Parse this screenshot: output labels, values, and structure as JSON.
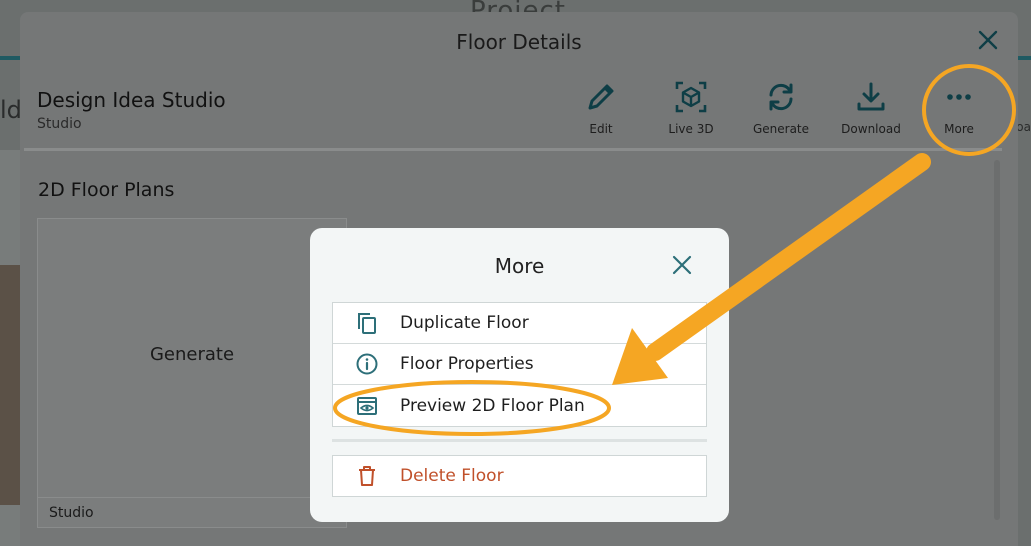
{
  "background": {
    "title": "Project",
    "left_fragment": "ld",
    "right_fragment": "oa"
  },
  "dialog": {
    "title": "Floor Details",
    "project_name": "Design Idea Studio",
    "project_type": "Studio",
    "toolbar": [
      {
        "label": "Edit",
        "icon": "pencil-icon"
      },
      {
        "label": "Live 3D",
        "icon": "cube-scan-icon"
      },
      {
        "label": "Generate",
        "icon": "sync-icon"
      },
      {
        "label": "Download",
        "icon": "download-icon"
      },
      {
        "label": "More",
        "icon": "more-dots-icon"
      }
    ],
    "section_title": "2D Floor Plans",
    "card": {
      "action_label": "Generate",
      "footer_label": "Studio"
    }
  },
  "more_menu": {
    "title": "More",
    "items": [
      {
        "label": "Duplicate Floor",
        "icon": "copy-icon"
      },
      {
        "label": "Floor Properties",
        "icon": "info-icon"
      },
      {
        "label": "Preview 2D Floor Plan",
        "icon": "preview-eye-icon"
      }
    ],
    "delete_label": "Delete Floor"
  },
  "colors": {
    "accent": "#2d6f79",
    "annotation": "#f5a623",
    "danger": "#c0502a"
  }
}
